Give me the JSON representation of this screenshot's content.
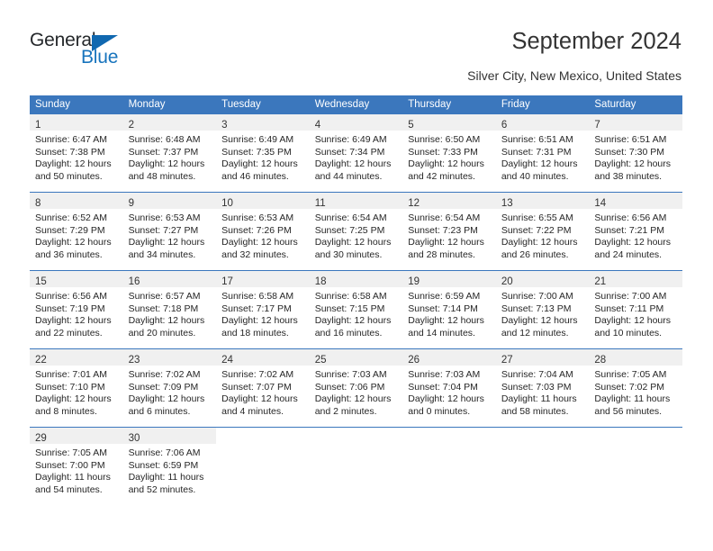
{
  "brand": {
    "name_part1": "General",
    "name_part2": "Blue",
    "accent_color": "#1874bd",
    "triangle_color": "#1068b0"
  },
  "header": {
    "title": "September 2024",
    "subtitle": "Silver City, New Mexico, United States"
  },
  "theme": {
    "header_bar_color": "#3b77bd",
    "daynum_band_color": "#f0f0f0",
    "text_color": "#262626"
  },
  "weekdays": [
    "Sunday",
    "Monday",
    "Tuesday",
    "Wednesday",
    "Thursday",
    "Friday",
    "Saturday"
  ],
  "weeks": [
    [
      {
        "day": "1",
        "sunrise": "Sunrise: 6:47 AM",
        "sunset": "Sunset: 7:38 PM",
        "daylight1": "Daylight: 12 hours",
        "daylight2": "and 50 minutes."
      },
      {
        "day": "2",
        "sunrise": "Sunrise: 6:48 AM",
        "sunset": "Sunset: 7:37 PM",
        "daylight1": "Daylight: 12 hours",
        "daylight2": "and 48 minutes."
      },
      {
        "day": "3",
        "sunrise": "Sunrise: 6:49 AM",
        "sunset": "Sunset: 7:35 PM",
        "daylight1": "Daylight: 12 hours",
        "daylight2": "and 46 minutes."
      },
      {
        "day": "4",
        "sunrise": "Sunrise: 6:49 AM",
        "sunset": "Sunset: 7:34 PM",
        "daylight1": "Daylight: 12 hours",
        "daylight2": "and 44 minutes."
      },
      {
        "day": "5",
        "sunrise": "Sunrise: 6:50 AM",
        "sunset": "Sunset: 7:33 PM",
        "daylight1": "Daylight: 12 hours",
        "daylight2": "and 42 minutes."
      },
      {
        "day": "6",
        "sunrise": "Sunrise: 6:51 AM",
        "sunset": "Sunset: 7:31 PM",
        "daylight1": "Daylight: 12 hours",
        "daylight2": "and 40 minutes."
      },
      {
        "day": "7",
        "sunrise": "Sunrise: 6:51 AM",
        "sunset": "Sunset: 7:30 PM",
        "daylight1": "Daylight: 12 hours",
        "daylight2": "and 38 minutes."
      }
    ],
    [
      {
        "day": "8",
        "sunrise": "Sunrise: 6:52 AM",
        "sunset": "Sunset: 7:29 PM",
        "daylight1": "Daylight: 12 hours",
        "daylight2": "and 36 minutes."
      },
      {
        "day": "9",
        "sunrise": "Sunrise: 6:53 AM",
        "sunset": "Sunset: 7:27 PM",
        "daylight1": "Daylight: 12 hours",
        "daylight2": "and 34 minutes."
      },
      {
        "day": "10",
        "sunrise": "Sunrise: 6:53 AM",
        "sunset": "Sunset: 7:26 PM",
        "daylight1": "Daylight: 12 hours",
        "daylight2": "and 32 minutes."
      },
      {
        "day": "11",
        "sunrise": "Sunrise: 6:54 AM",
        "sunset": "Sunset: 7:25 PM",
        "daylight1": "Daylight: 12 hours",
        "daylight2": "and 30 minutes."
      },
      {
        "day": "12",
        "sunrise": "Sunrise: 6:54 AM",
        "sunset": "Sunset: 7:23 PM",
        "daylight1": "Daylight: 12 hours",
        "daylight2": "and 28 minutes."
      },
      {
        "day": "13",
        "sunrise": "Sunrise: 6:55 AM",
        "sunset": "Sunset: 7:22 PM",
        "daylight1": "Daylight: 12 hours",
        "daylight2": "and 26 minutes."
      },
      {
        "day": "14",
        "sunrise": "Sunrise: 6:56 AM",
        "sunset": "Sunset: 7:21 PM",
        "daylight1": "Daylight: 12 hours",
        "daylight2": "and 24 minutes."
      }
    ],
    [
      {
        "day": "15",
        "sunrise": "Sunrise: 6:56 AM",
        "sunset": "Sunset: 7:19 PM",
        "daylight1": "Daylight: 12 hours",
        "daylight2": "and 22 minutes."
      },
      {
        "day": "16",
        "sunrise": "Sunrise: 6:57 AM",
        "sunset": "Sunset: 7:18 PM",
        "daylight1": "Daylight: 12 hours",
        "daylight2": "and 20 minutes."
      },
      {
        "day": "17",
        "sunrise": "Sunrise: 6:58 AM",
        "sunset": "Sunset: 7:17 PM",
        "daylight1": "Daylight: 12 hours",
        "daylight2": "and 18 minutes."
      },
      {
        "day": "18",
        "sunrise": "Sunrise: 6:58 AM",
        "sunset": "Sunset: 7:15 PM",
        "daylight1": "Daylight: 12 hours",
        "daylight2": "and 16 minutes."
      },
      {
        "day": "19",
        "sunrise": "Sunrise: 6:59 AM",
        "sunset": "Sunset: 7:14 PM",
        "daylight1": "Daylight: 12 hours",
        "daylight2": "and 14 minutes."
      },
      {
        "day": "20",
        "sunrise": "Sunrise: 7:00 AM",
        "sunset": "Sunset: 7:13 PM",
        "daylight1": "Daylight: 12 hours",
        "daylight2": "and 12 minutes."
      },
      {
        "day": "21",
        "sunrise": "Sunrise: 7:00 AM",
        "sunset": "Sunset: 7:11 PM",
        "daylight1": "Daylight: 12 hours",
        "daylight2": "and 10 minutes."
      }
    ],
    [
      {
        "day": "22",
        "sunrise": "Sunrise: 7:01 AM",
        "sunset": "Sunset: 7:10 PM",
        "daylight1": "Daylight: 12 hours",
        "daylight2": "and 8 minutes."
      },
      {
        "day": "23",
        "sunrise": "Sunrise: 7:02 AM",
        "sunset": "Sunset: 7:09 PM",
        "daylight1": "Daylight: 12 hours",
        "daylight2": "and 6 minutes."
      },
      {
        "day": "24",
        "sunrise": "Sunrise: 7:02 AM",
        "sunset": "Sunset: 7:07 PM",
        "daylight1": "Daylight: 12 hours",
        "daylight2": "and 4 minutes."
      },
      {
        "day": "25",
        "sunrise": "Sunrise: 7:03 AM",
        "sunset": "Sunset: 7:06 PM",
        "daylight1": "Daylight: 12 hours",
        "daylight2": "and 2 minutes."
      },
      {
        "day": "26",
        "sunrise": "Sunrise: 7:03 AM",
        "sunset": "Sunset: 7:04 PM",
        "daylight1": "Daylight: 12 hours",
        "daylight2": "and 0 minutes."
      },
      {
        "day": "27",
        "sunrise": "Sunrise: 7:04 AM",
        "sunset": "Sunset: 7:03 PM",
        "daylight1": "Daylight: 11 hours",
        "daylight2": "and 58 minutes."
      },
      {
        "day": "28",
        "sunrise": "Sunrise: 7:05 AM",
        "sunset": "Sunset: 7:02 PM",
        "daylight1": "Daylight: 11 hours",
        "daylight2": "and 56 minutes."
      }
    ],
    [
      {
        "day": "29",
        "sunrise": "Sunrise: 7:05 AM",
        "sunset": "Sunset: 7:00 PM",
        "daylight1": "Daylight: 11 hours",
        "daylight2": "and 54 minutes."
      },
      {
        "day": "30",
        "sunrise": "Sunrise: 7:06 AM",
        "sunset": "Sunset: 6:59 PM",
        "daylight1": "Daylight: 11 hours",
        "daylight2": "and 52 minutes."
      },
      {
        "day": "",
        "sunrise": "",
        "sunset": "",
        "daylight1": "",
        "daylight2": ""
      },
      {
        "day": "",
        "sunrise": "",
        "sunset": "",
        "daylight1": "",
        "daylight2": ""
      },
      {
        "day": "",
        "sunrise": "",
        "sunset": "",
        "daylight1": "",
        "daylight2": ""
      },
      {
        "day": "",
        "sunrise": "",
        "sunset": "",
        "daylight1": "",
        "daylight2": ""
      },
      {
        "day": "",
        "sunrise": "",
        "sunset": "",
        "daylight1": "",
        "daylight2": ""
      }
    ]
  ]
}
